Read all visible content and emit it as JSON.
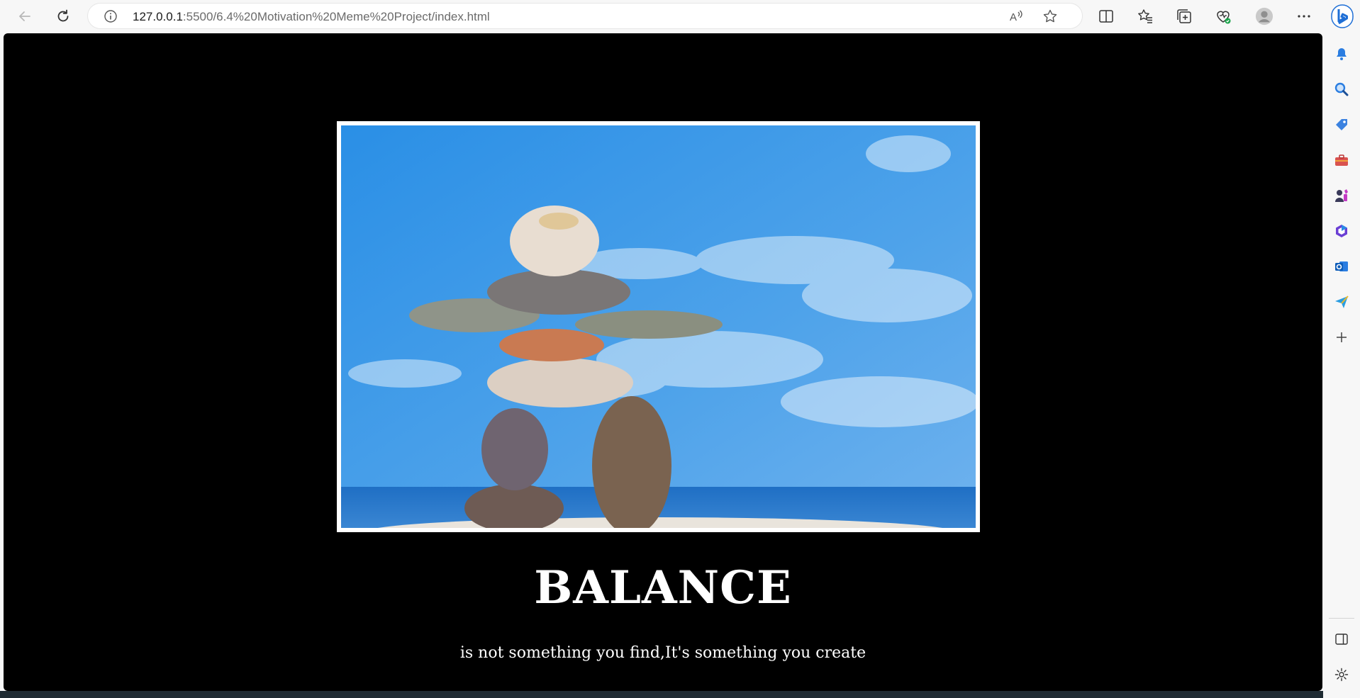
{
  "browser": {
    "url_host": "127.0.0.1",
    "url_rest": ":5500/6.4%20Motivation%20Meme%20Project/index.html"
  },
  "toolbar_icons": [
    "split-screen-icon",
    "favorites-icon",
    "collections-icon",
    "browser-essentials-icon",
    "profile-icon",
    "more-icon",
    "copilot-icon"
  ],
  "sidebar_icons": [
    "notifications-icon",
    "search-icon",
    "shopping-icon",
    "tools-icon",
    "games-icon",
    "microsoft-365-icon",
    "outlook-icon",
    "send-icon",
    "add-icon",
    "sidebar-toggle-icon",
    "settings-icon"
  ],
  "page": {
    "headline": "BALANCE",
    "tagline": "is not something you find,It's something you create",
    "background_color": "#000000",
    "text_color": "#ffffff"
  },
  "colors": {
    "accent": "#1a73e8",
    "sky": "#2f93e3"
  }
}
